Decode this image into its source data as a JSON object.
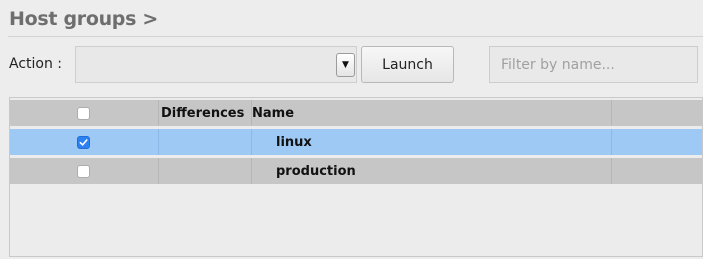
{
  "page": {
    "title": "Host groups >"
  },
  "toolbar": {
    "action_label": "Action :",
    "action_value": "",
    "launch_label": "Launch",
    "filter_placeholder": "Filter by name..."
  },
  "table": {
    "columns": {
      "differences": "Differences",
      "name": "Name"
    },
    "rows": [
      {
        "checked": true,
        "selected": true,
        "differences": "",
        "name": "linux"
      },
      {
        "checked": false,
        "selected": false,
        "differences": "",
        "name": "production"
      }
    ]
  },
  "colors": {
    "selected_row": "#9fc9f5",
    "header_row": "#c6c6c6",
    "checkbox_checked": "#2c80f1"
  }
}
